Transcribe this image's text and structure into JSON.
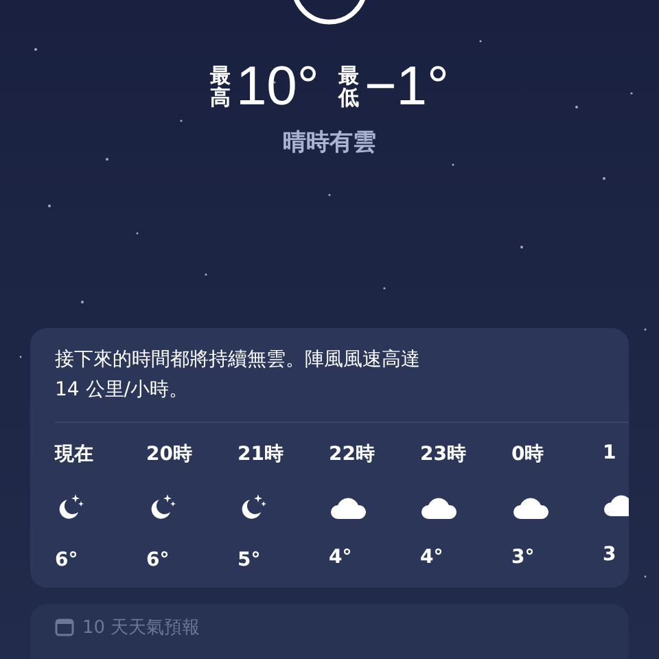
{
  "today": {
    "high_label": "最高",
    "high": "10°",
    "low_label": "最低",
    "low": "−1°",
    "condition": "晴時有雲"
  },
  "hourly": {
    "summary": "接下來的時間都將持續無雲。陣風風速高達 14 公里/小時。",
    "hours": [
      {
        "time": "現在",
        "kind": "moon",
        "temp": "6°"
      },
      {
        "time": "20時",
        "kind": "moon",
        "temp": "6°"
      },
      {
        "time": "21時",
        "kind": "moon",
        "temp": "5°"
      },
      {
        "time": "22時",
        "kind": "cloud",
        "temp": "4°"
      },
      {
        "time": "23時",
        "kind": "cloud",
        "temp": "4°"
      },
      {
        "time": "0時",
        "kind": "cloud",
        "temp": "3°"
      },
      {
        "time": "1",
        "kind": "cloud",
        "temp": "3"
      }
    ]
  },
  "forecast": {
    "title": "10 天天氣預報"
  }
}
